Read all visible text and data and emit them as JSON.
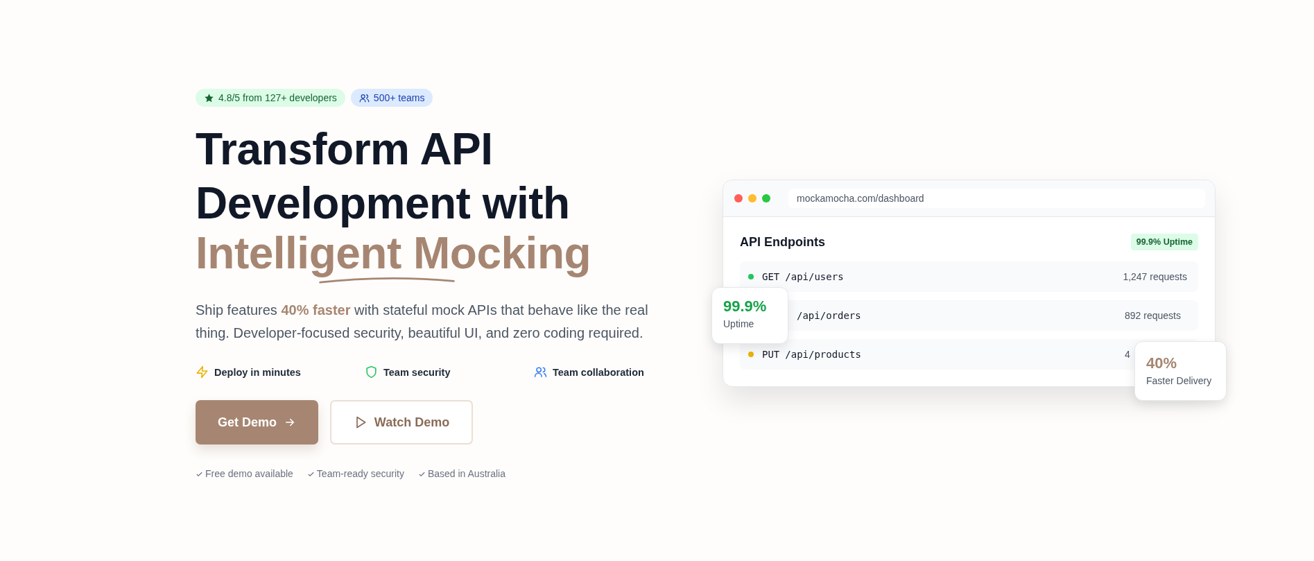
{
  "badges": [
    {
      "kind": "rating",
      "label": "4.8/5 from 127+ developers"
    },
    {
      "kind": "teams",
      "label": "500+ teams"
    }
  ],
  "headline": {
    "lines": [
      "Transform API",
      "Development with"
    ],
    "accent": "Intelligent Mocking"
  },
  "description": "Ship features **40% faster** with stateful mock APIs that behave like the real thing. Developer-focused security, beautiful UI, and zero coding required.",
  "features": [
    {
      "kind": "bolt",
      "label": "Deploy in minutes"
    },
    {
      "kind": "shield",
      "label": "Team security"
    },
    {
      "kind": "users",
      "label": "Team collaboration"
    }
  ],
  "buttons": [
    {
      "kind": "primary",
      "label": "Get Demo"
    },
    {
      "kind": "secondary",
      "label": "Watch Demo"
    }
  ],
  "assurances": [
    "Free demo available",
    "Team-ready security",
    "Based in Australia"
  ],
  "preview": {
    "url": "mockamocha.com/dashboard",
    "title": "API Endpoints",
    "status": "99.9% Uptime",
    "endpoints": [
      {
        "method": "GET",
        "path": "/api/users",
        "requests": "1,247 requests",
        "color": "#22c55e"
      },
      {
        "path": "/api/orders",
        "requests": "892 requests"
      },
      {
        "method": "PUT",
        "path": "/api/products",
        "requests": "4",
        "color": "#eab308"
      }
    ]
  },
  "stats": [
    {
      "kind": "uptime",
      "value": "99.9%",
      "label": "Uptime"
    },
    {
      "kind": "delivery",
      "value": "40%",
      "label": "Faster Delivery"
    }
  ]
}
